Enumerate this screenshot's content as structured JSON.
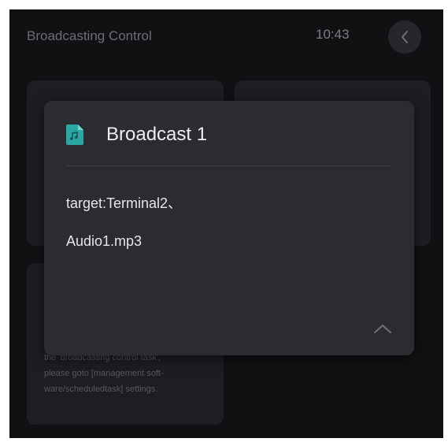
{
  "header": {
    "title": "Broadcasting Control",
    "time": "10:43"
  },
  "background_card": {
    "note_lines": [
      "the 'broadcasting control task',",
      "please goto [management soft-",
      "ware/scheduledtask] settings."
    ]
  },
  "modal": {
    "title": "Broadcast 1",
    "icon": "music-file-icon",
    "target": "target:Terminal2、",
    "audio": "Audio1.mp3",
    "collapse_icon": "chevron-up-icon"
  },
  "colors": {
    "screen_bg": "#111113",
    "card_bg": "#1d1e22",
    "modal_bg": "#2a2c31",
    "accent": "#2aa7a3"
  }
}
